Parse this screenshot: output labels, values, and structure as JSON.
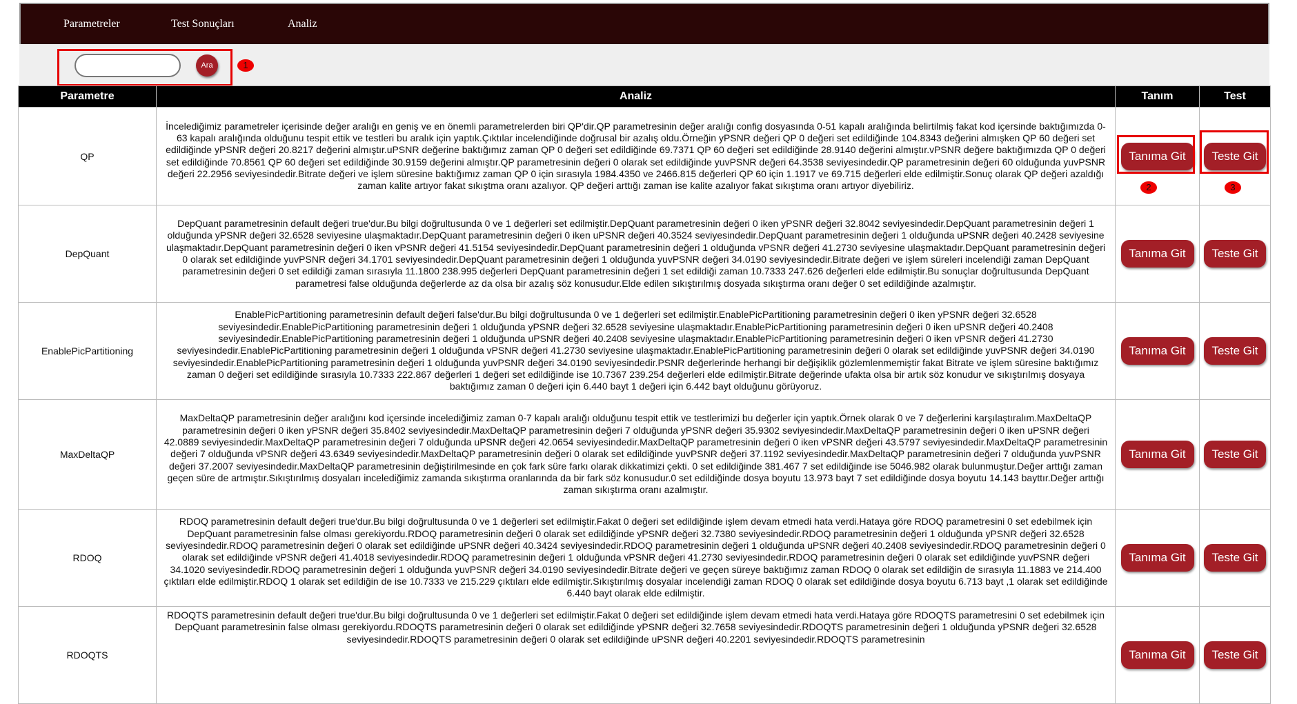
{
  "nav": {
    "items": [
      "Parametreler",
      "Test Sonuçları",
      "Analiz"
    ]
  },
  "search": {
    "button_label": "Ara",
    "value": "",
    "placeholder": ""
  },
  "markers": [
    "1",
    "2",
    "3"
  ],
  "table": {
    "headers": [
      "Parametre",
      "Analiz",
      "Tanım",
      "Test"
    ],
    "define_label": "Tanıma Git",
    "test_label": "Teste Git",
    "rows": [
      {
        "param": "QP",
        "analysis": "İncelediğimiz parametreler içerisinde değer aralığı en geniş ve en önemli parametrelerden biri QP'dir.QP parametresinin değer aralığı config dosyasında 0-51 kapalı aralığında belirtilmiş fakat kod içersinde baktığımızda 0-63 kapalı aralığında olduğunu tespit ettik ve testleri bu aralık için yaptık.Çıktılar incelendiğinde doğrusal bir azalış oldu.Örneğin yPSNR değeri QP 0 değeri set edildiğinde 104.8343 değerini almışken QP 60 değeri set edildiğinde yPSNR değeri 20.8217 değerini almıştır.uPSNR değerine baktığımız zaman QP 0 değeri set edildiğinde 69.7371 QP 60 değeri set edildiğinde 28.9140 değerini almıştır.vPSNR değere baktığımızda QP 0 değeri set edildiğinde 70.8561 QP 60 değeri set edildiğinde 30.9159 değerini almıştır.QP parametresinin değeri 0 olarak set edildiğinde yuvPSNR değeri 64.3538 seviyesindedir.QP parametresinin değeri 60 olduğunda yuvPSNR değeri 22.2956 seviyesindedir.Bitrate değeri ve işlem süresine baktığımız zaman QP 0 için sırasıyla 1984.4350 ve 2466.815 değerleri QP 60 için 1.1917 ve 69.715 değerleri elde edilmiştir.Sonuç olarak QP değeri azaldığı zaman kalite artıyor fakat sıkıştma oranı azalıyor. QP değeri arttığı zaman ise kalite azalıyor fakat sıkıştıma oranı artıyor diyebiliriz."
      },
      {
        "param": "DepQuant",
        "analysis": "DepQuant parametresinin default değeri true'dur.Bu bilgi doğrultusunda 0 ve 1 değerleri set edilmiştir.DepQuant parametresinin değeri 0 iken yPSNR değeri 32.8042 seviyesindedir.DepQuant parametresinin değeri 1 olduğunda yPSNR değeri 32.6528 seviyesine ulaşmaktadır.DepQuant parametresinin değeri 0 iken uPSNR değeri 40.3524 seviyesindedir.DepQuant parametresinin değeri 1 olduğunda uPSNR değeri 40.2428 seviyesine ulaşmaktadır.DepQuant parametresinin değeri 0 iken vPSNR değeri 41.5154 seviyesindedir.DepQuant parametresinin değeri 1 olduğunda vPSNR değeri 41.2730 seviyesine ulaşmaktadır.DepQuant parametresinin değeri 0 olarak set edildiğinde yuvPSNR değeri 34.1701 seviyesindedir.DepQuant parametresinin değeri 1 olduğunda yuvPSNR değeri 34.0190 seviyesindedir.Bitrate değeri ve işlem süreleri incelendiği zaman DepQuant parametresinin değeri 0 set edildiği zaman sırasıyla 11.1800 238.995 değerleri DepQuant parametresinin değeri 1 set edildiği zaman 10.7333 247.626 değerleri elde edilmiştir.Bu sonuçlar doğrultusunda DepQuant parametresi false olduğunda değerlerde az da olsa bir azalış söz konusudur.Elde edilen sıkıştırılmış dosyada sıkıştırma oranı değer 0 set edildiğinde azalmıştır."
      },
      {
        "param": "EnablePicPartitioning",
        "analysis": "EnablePicPartitioning parametresinin default değeri false'dur.Bu bilgi doğrultusunda 0 ve 1 değerleri set edilmiştir.EnablePicPartitioning parametresinin değeri 0 iken yPSNR değeri 32.6528 seviyesindedir.EnablePicPartitioning parametresinin değeri 1 olduğunda yPSNR değeri 32.6528 seviyesine ulaşmaktadır.EnablePicPartitioning parametresinin değeri 0 iken uPSNR değeri 40.2408 seviyesindedir.EnablePicPartitioning parametresinin değeri 1 olduğunda uPSNR değeri 40.2408 seviyesine ulaşmaktadır.EnablePicPartitioning parametresinin değeri 0 iken vPSNR değeri 41.2730 seviyesindedir.EnablePicPartitioning parametresinin değeri 1 olduğunda vPSNR değeri 41.2730 seviyesine ulaşmaktadır.EnablePicPartitioning parametresinin değeri 0 olarak set edildiğinde yuvPSNR değeri 34.0190 seviyesindedir.EnablePicPartitioning parametresinin değeri 1 olduğunda yuvPSNR değeri 34.0190 seviyesindedir.PSNR değerlerinde herhangi bir değişiklik gözlemlenmemiştir fakat Bitrate ve işlem süresine baktığımız zaman 0 değeri set edildiğinde sırasıyla 10.7333 222.867 değerleri 1 değeri set edildiğinde ise 10.7367 239.254 değerleri elde edilmiştir.Bitrate değerinde ufakta olsa bir artık söz konudur ve sıkıştırılmış dosyaya baktığımız zaman 0 değeri için 6.440 bayt 1 değeri için 6.442 bayt olduğunu görüyoruz."
      },
      {
        "param": "MaxDeltaQP",
        "analysis": "MaxDeltaQP parametresinin değer aralığını kod içersinde incelediğimiz zaman 0-7 kapalı aralığı olduğunu tespit ettik ve testlerimizi bu değerler için yaptık.Örnek olarak 0 ve 7 değerlerini karşılaştıralım.MaxDeltaQP parametresinin değeri 0 iken yPSNR değeri 35.8402 seviyesindedir.MaxDeltaQP parametresinin değeri 7 olduğunda yPSNR değeri 35.9302 seviyesindedir.MaxDeltaQP parametresinin değeri 0 iken uPSNR değeri 42.0889 seviyesindedir.MaxDeltaQP parametresinin değeri 7 olduğunda uPSNR değeri 42.0654 seviyesindedir.MaxDeltaQP parametresinin değeri 0 iken vPSNR değeri 43.5797 seviyesindedir.MaxDeltaQP parametresinin değeri 7 olduğunda vPSNR değeri 43.6349 seviyesindedir.MaxDeltaQP parametresinin değeri 0 olarak set edildiğinde yuvPSNR değeri 37.1192 seviyesindedir.MaxDeltaQP parametresinin değeri 7 olduğunda yuvPSNR değeri 37.2007 seviyesindedir.MaxDeltaQP parametresinin değiştirilmesinde en çok fark süre farkı olarak dikkatimizi çekti. 0 set edildiğinde 381.467 7 set edildiğinde ise 5046.982 olarak bulunmuştur.Değer arttığı zaman geçen süre de artmıştır.Sıkıştırılmış dosyaları incelediğimiz zamanda sıkıştırma oranlarında da bir fark söz konusudur.0 set edildiğinde dosya boyutu 13.973 bayt 7 set edildiğinde dosya boyutu 14.143 bayttır.Değer arttığı zaman sıkıştırma oranı azalmıştır."
      },
      {
        "param": "RDOQ",
        "analysis": "RDOQ parametresinin default değeri true'dur.Bu bilgi doğrultusunda 0 ve 1 değerleri set edilmiştir.Fakat 0 değeri set edildiğinde işlem devam etmedi hata verdi.Hataya göre RDOQ parametresini 0 set edebilmek için DepQuant parametresinin false olması gerekiyordu.RDOQ parametresinin değeri 0 olarak set edildiğinde yPSNR değeri 32.7380 seviyesindedir.RDOQ parametresinin değeri 1 olduğunda yPSNR değeri 32.6528 seviyesindedir.RDOQ parametresinin değeri 0 olarak set edildiğinde uPSNR değeri 40.3424 seviyesindedir.RDOQ parametresinin değeri 1 olduğunda uPSNR değeri 40.2408 seviyesindedir.RDOQ parametresinin değeri 0 olarak set edildiğinde vPSNR değeri 41.4018 seviyesindedir.RDOQ parametresinin değeri 1 olduğunda vPSNR değeri 41.2730 seviyesindedir.RDOQ parametresinin değeri 0 olarak set edildiğinde yuvPSNR değeri 34.1020 seviyesindedir.RDOQ parametresinin değeri 1 olduğunda yuvPSNR değeri 34.0190 seviyesindedir.Bitrate değeri ve geçen süreye baktığımız zaman RDOQ 0 olarak set edildiğin de sırasıyla 11.1883 ve 214.400 çıktıları elde edilmiştir.RDOQ 1 olarak set edildiğin de ise 10.7333 ve 215.229 çıktıları elde edilmiştir.Sıkıştırılmış dosyalar incelendiği zaman RDOQ 0 olarak set edildiğinde dosya boyutu 6.713 bayt ,1 olarak set edildiğinde 6.440 bayt olarak elde edilmiştir."
      },
      {
        "param": "RDOQTS",
        "analysis": "RDOQTS parametresinin default değeri true'dur.Bu bilgi doğrultusunda 0 ve 1 değerleri set edilmiştir.Fakat 0 değeri set edildiğinde işlem devam etmedi hata verdi.Hataya göre RDOQTS parametresini 0 set edebilmek için DepQuant parametresinin false olması gerekiyordu.RDOQTS parametresinin değeri 0 olarak set edildiğinde yPSNR değeri 32.7658 seviyesindedir.RDOQTS parametresinin değeri 1 olduğunda yPSNR değeri 32.6528 seviyesindedir.RDOQTS parametresinin değeri 0 olarak set edildiğinde uPSNR değeri 40.2201 seviyesindedir.RDOQTS parametresinin"
      }
    ]
  },
  "colors": {
    "accent": "#a31f27",
    "nav_bg": "#2a0606",
    "highlight": "#e60000"
  }
}
